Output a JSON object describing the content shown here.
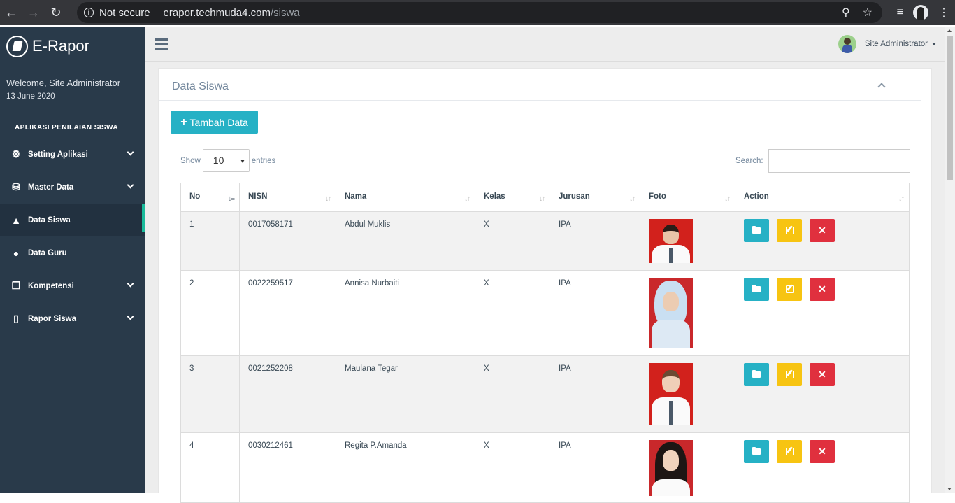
{
  "browser": {
    "security_label": "Not secure",
    "url_host": "erapor.techmuda4.com",
    "url_path": "/siswa"
  },
  "sidebar": {
    "brand": "E-Rapor",
    "welcome": "Welcome, Site Administrator",
    "date": "13 June 2020",
    "section_title": "APLIKASI PENILAIAN SISWA",
    "items": [
      {
        "label": "Setting Aplikasi",
        "icon": "gear-icon",
        "expandable": true
      },
      {
        "label": "Master Data",
        "icon": "database-icon",
        "expandable": true
      },
      {
        "label": "Data Siswa",
        "icon": "graduation-cap-icon",
        "expandable": false,
        "active": true
      },
      {
        "label": "Data Guru",
        "icon": "user-icon",
        "expandable": false
      },
      {
        "label": "Kompetensi",
        "icon": "copy-icon",
        "expandable": true
      },
      {
        "label": "Rapor Siswa",
        "icon": "book-icon",
        "expandable": true
      }
    ]
  },
  "topbar": {
    "user_name": "Site Administrator"
  },
  "panel": {
    "title": "Data Siswa",
    "add_button": "Tambah Data",
    "show_label": "Show",
    "entries_value": "10",
    "entries_label": "entries",
    "search_label": "Search:",
    "search_value": ""
  },
  "table": {
    "columns": [
      "No",
      "NISN",
      "Nama",
      "Kelas",
      "Jurusan",
      "Foto",
      "Action"
    ],
    "rows": [
      {
        "no": "1",
        "nisn": "0017058171",
        "nama": "Abdul Muklis",
        "kelas": "X",
        "jurusan": "IPA"
      },
      {
        "no": "2",
        "nisn": "0022259517",
        "nama": "Annisa Nurbaiti",
        "kelas": "X",
        "jurusan": "IPA"
      },
      {
        "no": "3",
        "nisn": "0021252208",
        "nama": "Maulana Tegar",
        "kelas": "X",
        "jurusan": "IPA"
      },
      {
        "no": "4",
        "nisn": "0030212461",
        "nama": "Regita P.Amanda",
        "kelas": "X",
        "jurusan": "IPA"
      }
    ]
  },
  "colors": {
    "sidebar_bg": "#293a4a",
    "accent_teal": "#26b1c5",
    "warning": "#f7c412",
    "danger": "#e0303e",
    "active_marker": "#1abc9c"
  }
}
